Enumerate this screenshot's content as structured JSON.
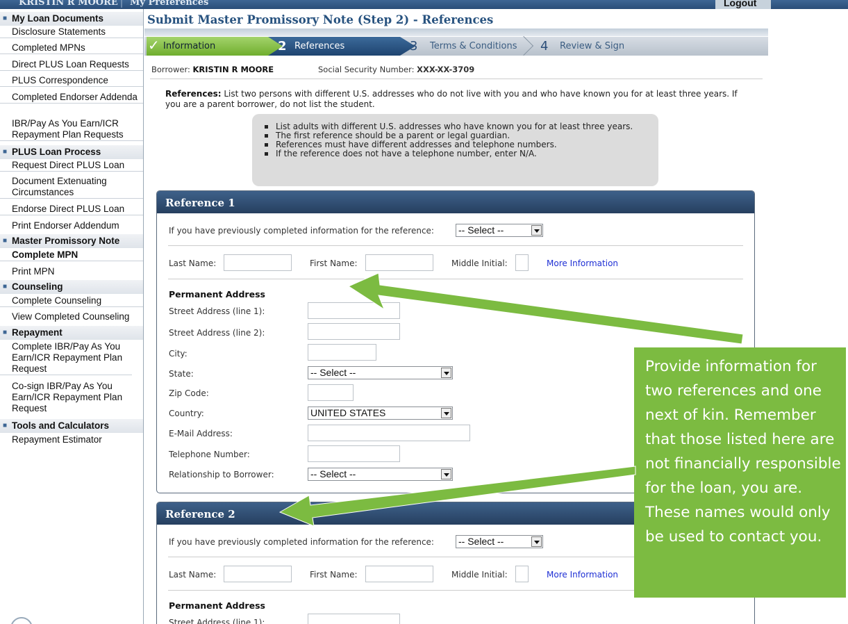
{
  "topbar": {
    "user_name": "KRISTIN R MOORE",
    "separator": "|",
    "preferences": "My Preferences",
    "logout": "Logout"
  },
  "sidebar": {
    "sections": [
      {
        "title": "My Loan Documents",
        "items": [
          "Disclosure Statements",
          "Completed MPNs",
          "Direct PLUS Loan Requests",
          "PLUS Correspondence",
          "Completed Endorser Addenda",
          "IBR/Pay As You Earn/ICR Repayment Plan Requests"
        ]
      },
      {
        "title": "PLUS Loan Process",
        "items": [
          "Request Direct PLUS Loan",
          "Document Extenuating Circumstances",
          "Endorse Direct PLUS Loan",
          "Print Endorser Addendum"
        ]
      },
      {
        "title": "Master Promissory Note",
        "items": [
          "Complete MPN",
          "Print MPN"
        ]
      },
      {
        "title": "Counseling",
        "items": [
          "Complete Counseling",
          "View Completed Counseling"
        ]
      },
      {
        "title": "Repayment",
        "items": [
          "Complete IBR/Pay As You Earn/ICR Repayment Plan Request",
          "Co-sign IBR/Pay As You Earn/ICR Repayment Plan Request"
        ]
      },
      {
        "title": "Tools and Calculators",
        "items": [
          "Repayment Estimator"
        ]
      }
    ]
  },
  "page": {
    "title": "Submit Master Promissory Note (Step 2) - References",
    "steps": [
      {
        "number": "",
        "label": "Information",
        "state": "complete"
      },
      {
        "number": "2",
        "label": "References",
        "state": "current"
      },
      {
        "number": "3",
        "label": "Terms & Conditions",
        "state": "upcoming"
      },
      {
        "number": "4",
        "label": "Review & Sign",
        "state": "upcoming"
      }
    ],
    "borrower_label": "Borrower:",
    "borrower_name": "KRISTIN R MOORE",
    "ssn_label": "Social Security Number:",
    "ssn_value": "XXX-XX-3709",
    "refs_intro_bold": "References:",
    "refs_intro_text": " List two persons with different U.S. addresses who do not live with you and who have known you for at least three years. If you are a parent borrower, do not list the student.",
    "tips": [
      "List adults with different U.S. addresses who have known you for at least three years.",
      "The first reference should be a parent or legal guardian.",
      "References must have different addresses and telephone numbers.",
      "If the reference does not have a telephone number, enter N/A."
    ]
  },
  "form": {
    "prev_info_label": "If you have previously completed information for the reference:",
    "select_placeholder": "-- Select --",
    "last_name": "Last Name:",
    "first_name": "First Name:",
    "middle_initial": "Middle Initial:",
    "more_info": "More Information",
    "permanent_address": "Permanent Address",
    "street1": "Street Address (line 1):",
    "street2": "Street Address (line 2):",
    "city": "City:",
    "state": "State:",
    "zip": "Zip Code:",
    "country": "Country:",
    "email": "E-Mail Address:",
    "phone": "Telephone Number:",
    "relationship": "Relationship to Borrower:",
    "country_value": "UNITED STATES",
    "state_value": "-- Select --",
    "relationship_value": "-- Select --"
  },
  "references": [
    {
      "title": "Reference 1"
    },
    {
      "title": "Reference 2"
    }
  ],
  "callout": {
    "text": "Provide information for two references and one next of kin. Remember that those listed here are not financially responsible for the loan, you are. These names would only be used to contact you.",
    "color": "#7cbb41"
  }
}
